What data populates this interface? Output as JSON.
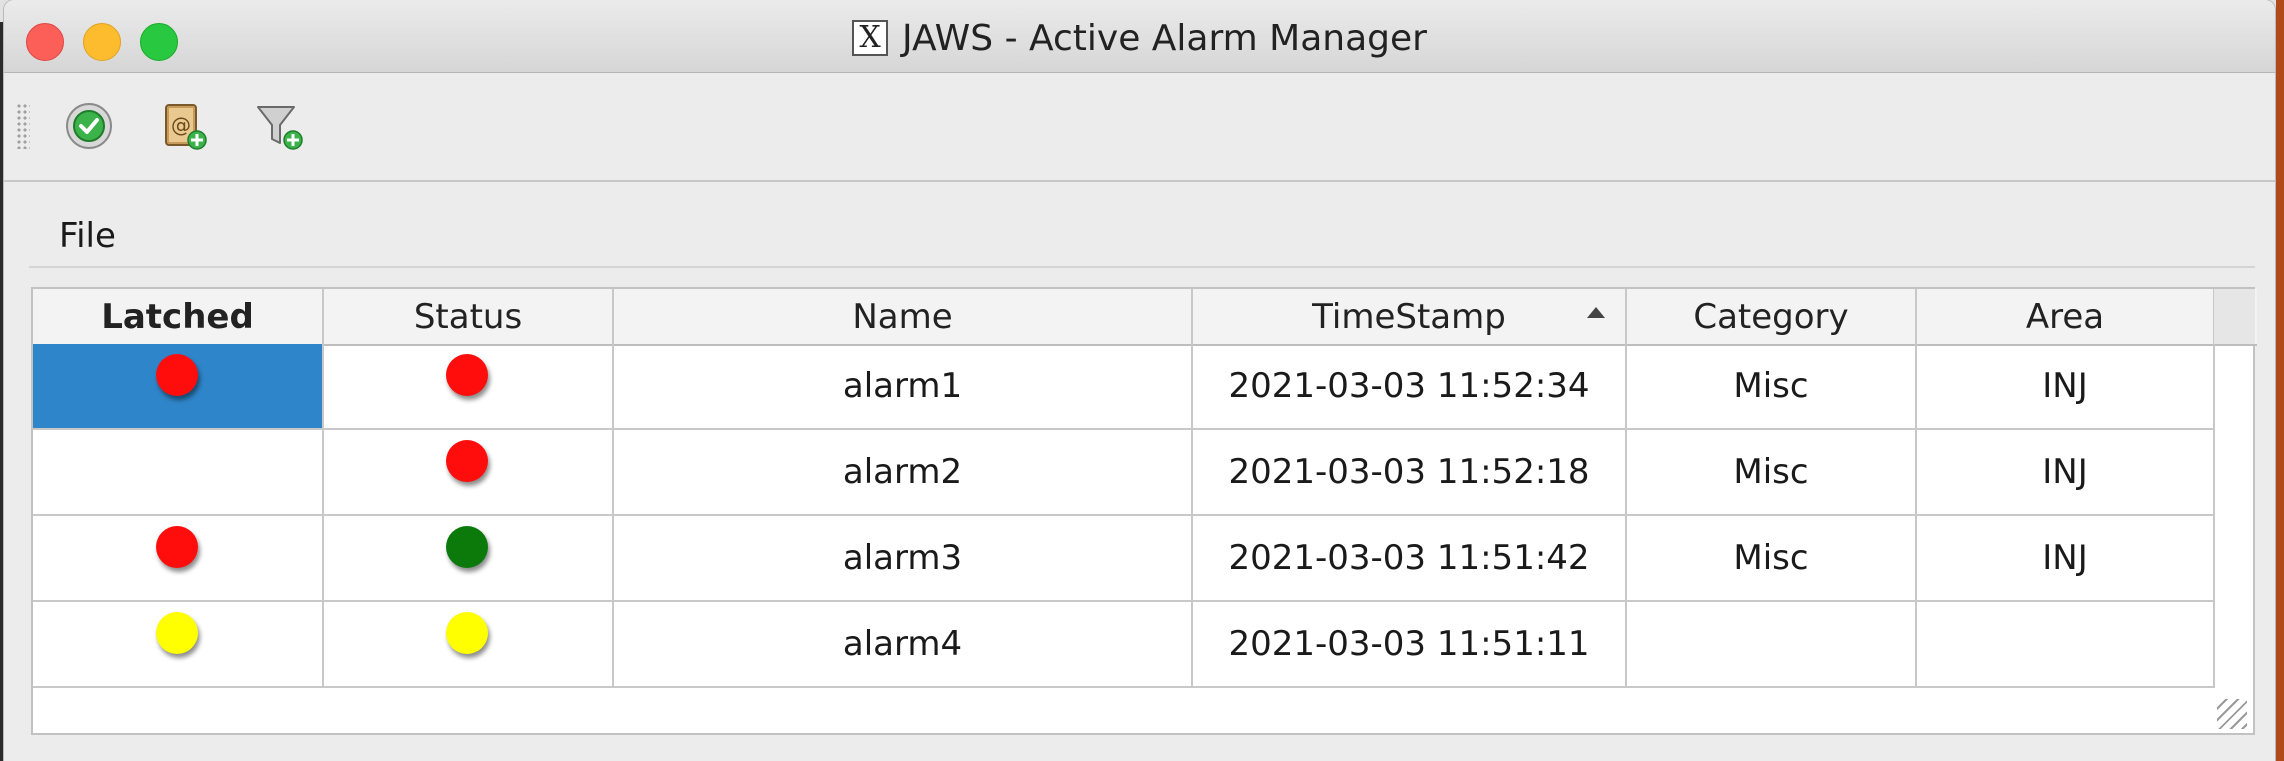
{
  "window": {
    "title": "JAWS - Active Alarm Manager"
  },
  "toolbar": {
    "buttons": [
      {
        "name": "acknowledge",
        "icon": "check-circle-icon"
      },
      {
        "name": "register",
        "icon": "address-book-add-icon"
      },
      {
        "name": "filter",
        "icon": "filter-add-icon"
      }
    ]
  },
  "menu": {
    "file": "File"
  },
  "table": {
    "columns": [
      "Latched",
      "Status",
      "Name",
      "TimeStamp",
      "Category",
      "Area"
    ],
    "sorted_column": "TimeStamp",
    "sort_direction": "ascending",
    "rows": [
      {
        "latched": "red",
        "status": "red",
        "name": "alarm1",
        "timestamp": "2021-03-03 11:52:34",
        "category": "Misc",
        "area": "INJ",
        "selected": true
      },
      {
        "latched": "",
        "status": "red",
        "name": "alarm2",
        "timestamp": "2021-03-03 11:52:18",
        "category": "Misc",
        "area": "INJ"
      },
      {
        "latched": "red",
        "status": "green",
        "name": "alarm3",
        "timestamp": "2021-03-03 11:51:42",
        "category": "Misc",
        "area": "INJ"
      },
      {
        "latched": "yellow",
        "status": "yellow",
        "name": "alarm4",
        "timestamp": "2021-03-03 11:51:11",
        "category": "",
        "area": ""
      }
    ]
  },
  "colors": {
    "red": "#ff0d0d",
    "green": "#0b7a0b",
    "yellow": "#ffff00",
    "selection": "#2f85c9"
  }
}
